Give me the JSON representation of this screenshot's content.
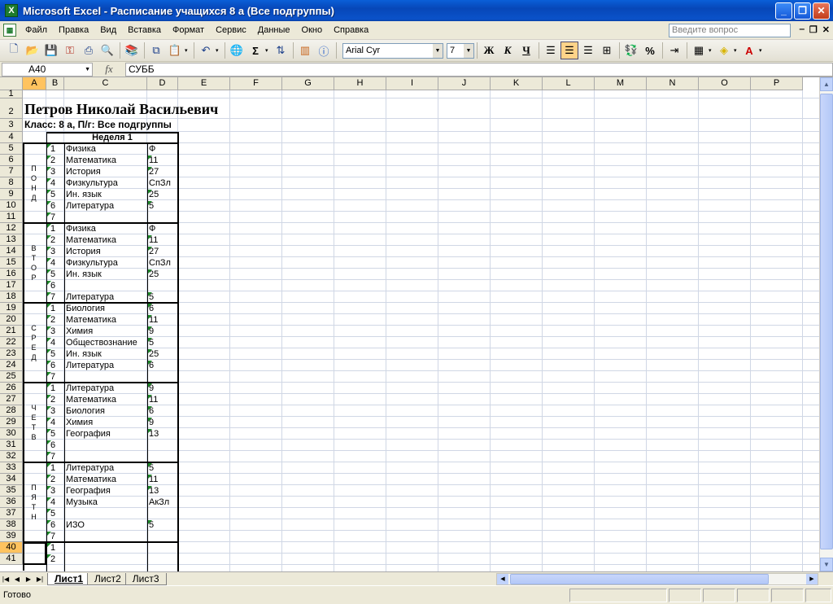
{
  "window": {
    "title": "Microsoft Excel - Расписание учащихся 8 а (Все подгруппы)",
    "controls": [
      "_",
      "❐",
      "✕"
    ]
  },
  "menu": {
    "items": [
      "Файл",
      "Правка",
      "Вид",
      "Вставка",
      "Формат",
      "Сервис",
      "Данные",
      "Окно",
      "Справка"
    ],
    "help_placeholder": "Введите вопрос",
    "mdi": [
      "‒",
      "❐",
      "✕"
    ]
  },
  "toolbar": {
    "font": "Arial Cyr",
    "size": "7",
    "bold": "Ж",
    "italic": "К",
    "underline": "Ч",
    "sum": "Σ",
    "percent": "%"
  },
  "formula_bar": {
    "name_box": "A40",
    "fx": "fx",
    "value": "СУББ"
  },
  "columns": [
    "A",
    "B",
    "C",
    "D",
    "E",
    "F",
    "G",
    "H",
    "I",
    "J",
    "K",
    "L",
    "M",
    "N",
    "O",
    "P"
  ],
  "rows": [
    "1",
    "2",
    "3",
    "4",
    "5",
    "6",
    "7",
    "8",
    "9",
    "10",
    "11",
    "12",
    "13",
    "14",
    "15",
    "16",
    "17",
    "18",
    "19",
    "20",
    "21",
    "22",
    "23",
    "24",
    "25",
    "26",
    "27",
    "28",
    "29",
    "30",
    "31",
    "32",
    "33",
    "34",
    "35",
    "36",
    "37",
    "38",
    "39",
    "40",
    "41"
  ],
  "sheet": {
    "student_name": "Петров Николай  Васильевич",
    "class_line": "Класс:  8 а, П/г: Все подгруппы",
    "week_label": "Неделя 1",
    "days": [
      {
        "letters": [
          "П",
          "О",
          "Н",
          "Д"
        ],
        "lessons": [
          {
            "n": "1",
            "subject": "Физика",
            "room": "Ф"
          },
          {
            "n": "2",
            "subject": "Математика",
            "room": "11"
          },
          {
            "n": "3",
            "subject": "История",
            "room": "27"
          },
          {
            "n": "4",
            "subject": "Физкультура",
            "room": "СпЗл"
          },
          {
            "n": "5",
            "subject": "Ин. язык",
            "room": "25"
          },
          {
            "n": "6",
            "subject": "Литература",
            "room": "5"
          },
          {
            "n": "7",
            "subject": "",
            "room": ""
          }
        ]
      },
      {
        "letters": [
          "В",
          "Т",
          "О",
          "Р"
        ],
        "lessons": [
          {
            "n": "1",
            "subject": "Физика",
            "room": "Ф"
          },
          {
            "n": "2",
            "subject": "Математика",
            "room": "11"
          },
          {
            "n": "3",
            "subject": "История",
            "room": "27"
          },
          {
            "n": "4",
            "subject": "Физкультура",
            "room": "СпЗл"
          },
          {
            "n": "5",
            "subject": "Ин. язык",
            "room": "25"
          },
          {
            "n": "6",
            "subject": "",
            "room": ""
          },
          {
            "n": "7",
            "subject": "Литература",
            "room": "5"
          }
        ]
      },
      {
        "letters": [
          "С",
          "Р",
          "Е",
          "Д"
        ],
        "lessons": [
          {
            "n": "1",
            "subject": "Биология",
            "room": "6"
          },
          {
            "n": "2",
            "subject": "Математика",
            "room": "11"
          },
          {
            "n": "3",
            "subject": "Химия",
            "room": "9"
          },
          {
            "n": "4",
            "subject": "Обществознание",
            "room": "5"
          },
          {
            "n": "5",
            "subject": "Ин. язык",
            "room": "25"
          },
          {
            "n": "6",
            "subject": "Литература",
            "room": "6"
          },
          {
            "n": "7",
            "subject": "",
            "room": ""
          }
        ]
      },
      {
        "letters": [
          "Ч",
          "Е",
          "Т",
          "В"
        ],
        "lessons": [
          {
            "n": "1",
            "subject": "Литература",
            "room": "9"
          },
          {
            "n": "2",
            "subject": "Математика",
            "room": "11"
          },
          {
            "n": "3",
            "subject": "Биология",
            "room": "6"
          },
          {
            "n": "4",
            "subject": "Химия",
            "room": "9"
          },
          {
            "n": "5",
            "subject": "География",
            "room": "13"
          },
          {
            "n": "6",
            "subject": "",
            "room": ""
          },
          {
            "n": "7",
            "subject": "",
            "room": ""
          }
        ]
      },
      {
        "letters": [
          "П",
          "Я",
          "Т",
          "Н"
        ],
        "lessons": [
          {
            "n": "1",
            "subject": "Литература",
            "room": "5"
          },
          {
            "n": "2",
            "subject": "Математика",
            "room": "11"
          },
          {
            "n": "3",
            "subject": "География",
            "room": "13"
          },
          {
            "n": "4",
            "subject": "Музыка",
            "room": "АкЗл"
          },
          {
            "n": "5",
            "subject": "",
            "room": ""
          },
          {
            "n": "6",
            "subject": "ИЗО",
            "room": "5"
          },
          {
            "n": "7",
            "subject": "",
            "room": ""
          }
        ]
      },
      {
        "letters": [],
        "lessons": [
          {
            "n": "1",
            "subject": "",
            "room": ""
          },
          {
            "n": "2",
            "subject": "",
            "room": ""
          }
        ]
      }
    ]
  },
  "sheet_tabs": [
    "Лист1",
    "Лист2",
    "Лист3"
  ],
  "active_tab": "Лист1",
  "status": "Готово",
  "colors": {
    "title_bar": "#0a52c9",
    "selected_header": "#ffc35f",
    "error_triangle": "#1f8a2b"
  }
}
